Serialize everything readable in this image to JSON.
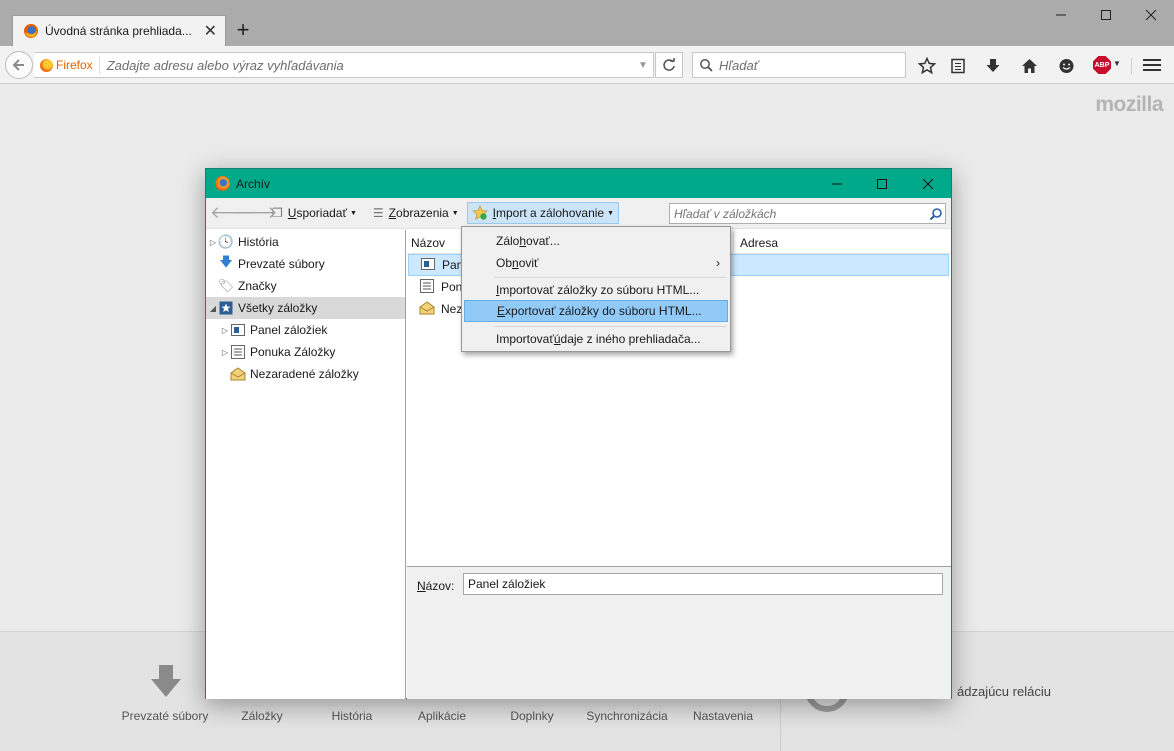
{
  "browser": {
    "tab_title": "Úvodná stránka prehliada...",
    "new_tab": "+",
    "identity_label": "Firefox",
    "url_placeholder": "Zadajte adresu alebo výraz vyhľadávania",
    "search_placeholder": "Hľadať",
    "abp_label": "ABP"
  },
  "startpage": {
    "brand": "mozilla",
    "launcher": [
      "Prevzaté súbory",
      "Záložky",
      "História",
      "Aplikácie",
      "Doplnky",
      "Synchronizácia",
      "Nastavenia"
    ],
    "restore_text": "ádzajúcu reláciu"
  },
  "library": {
    "title": "Archív",
    "toolbar": {
      "organize_label": "Usporiadať",
      "organize_accel": "U",
      "organize_rest": "sporiadať",
      "views_accel": "Z",
      "views_rest": "obrazenia",
      "import_accel": "I",
      "import_rest": "mport a zálohovanie"
    },
    "search_placeholder": "Hľadať v záložkách",
    "tree": [
      {
        "label": "História",
        "icon": "clock-icon"
      },
      {
        "label": "Prevzaté súbory",
        "icon": "download-icon"
      },
      {
        "label": "Značky",
        "icon": "tag-icon"
      },
      {
        "label": "Všetky záložky",
        "icon": "star-folder-icon"
      },
      {
        "label": "Panel záložiek",
        "icon": "toolbar-folder-icon"
      },
      {
        "label": "Ponuka Záložky",
        "icon": "menu-folder-icon"
      },
      {
        "label": "Nezaradené záložky",
        "icon": "unsorted-icon"
      }
    ],
    "columns": {
      "name": "Názov",
      "address": "Adresa"
    },
    "rows": [
      "Panel záložiek",
      "Ponuka Záložky",
      "Nezaradené záložky"
    ],
    "rows_visible": [
      "Pan",
      "Pon",
      "Nez"
    ],
    "detail": {
      "label_accel": "N",
      "label_rest": "ázov:",
      "value": "Panel záložiek"
    }
  },
  "menu": {
    "items": [
      {
        "pre": "Zálo",
        "accel": "h",
        "post": "ovať..."
      },
      {
        "pre": "Ob",
        "accel": "n",
        "post": "oviť"
      },
      {
        "pre": "",
        "accel": "I",
        "post": "mportovať záložky zo súboru HTML..."
      },
      {
        "pre": "",
        "accel": "E",
        "post": "xportovať záložky do súboru HTML..."
      },
      {
        "pre": "Importovať ",
        "accel": "ú",
        "post": "daje z iného prehliadača..."
      }
    ]
  },
  "colors": {
    "library_titlebar": "#00a989",
    "menu_highlight": "#91c9f7",
    "selection": "#cce8ff"
  }
}
